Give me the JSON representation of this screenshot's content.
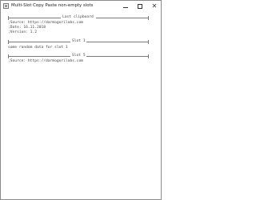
{
  "window": {
    "title": "Multi-Slot Copy Paste non-empty slots"
  },
  "sections": [
    {
      "header": "Last clipboard",
      "lines": [
        ";Source: https://darmogorilabs.com",
        ";Date: 16.11.2018",
        ";Version: 1.2"
      ]
    },
    {
      "header": "Slot 1",
      "lines": [
        "some random data for slot 1"
      ]
    },
    {
      "header": "Slot 5",
      "lines": [
        ";Source: https://darmogorilabs.com"
      ]
    }
  ],
  "icons": {
    "app": "app-icon",
    "minimize": "minimize-icon",
    "maximize": "maximize-icon",
    "close": "close-icon"
  }
}
